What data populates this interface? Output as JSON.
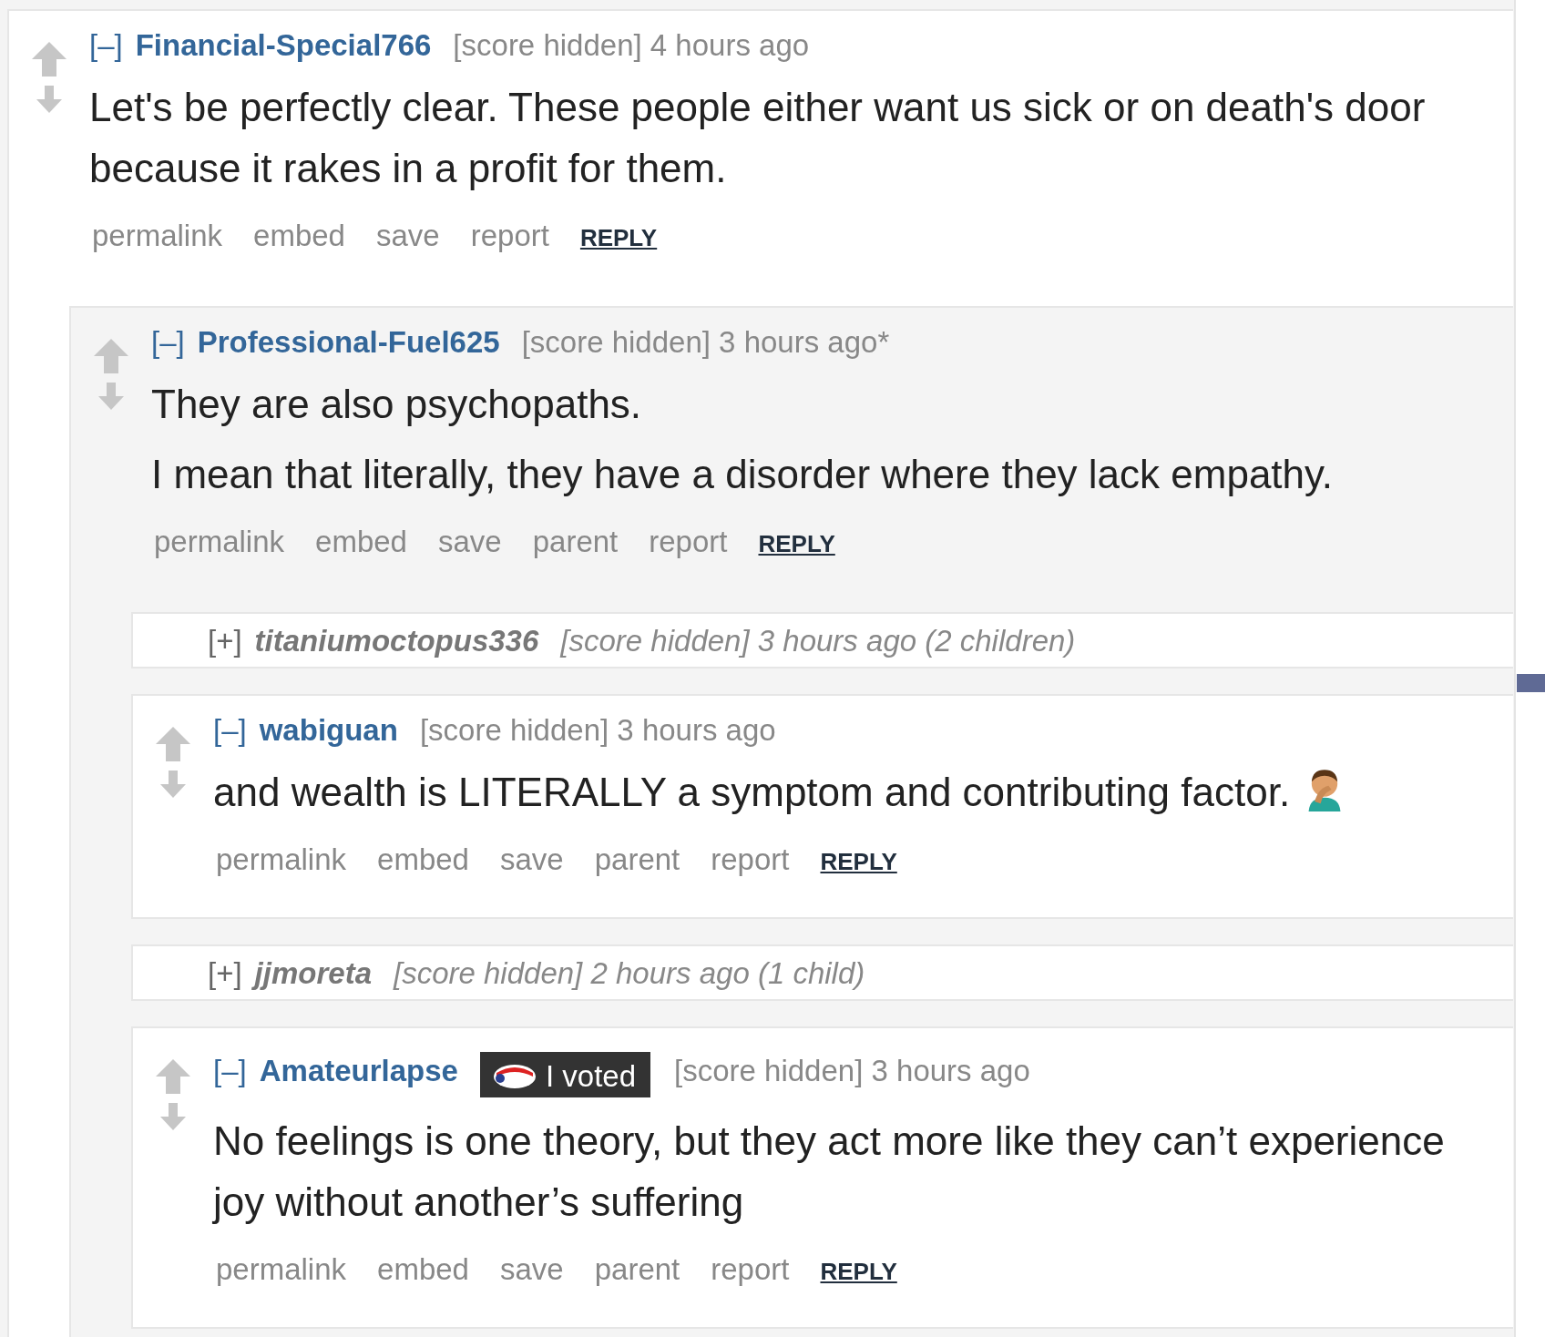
{
  "comments": [
    {
      "kind": "expanded",
      "toggle": "[–]",
      "author": "Financial-Special766",
      "score": "[score hidden]",
      "time": "4 hours ago",
      "body": [
        "Let's be perfectly clear. These people either want us sick or on death's door because it rakes in a profit for them."
      ],
      "buttons": [
        "permalink",
        "embed",
        "save",
        "report"
      ],
      "reply": "REPLY",
      "children": [
        {
          "kind": "expanded",
          "toggle": "[–]",
          "author": "Professional-Fuel625",
          "score": "[score hidden]",
          "time": "3 hours ago*",
          "body": [
            "They are also psychopaths.",
            "I mean that literally, they have a disorder where they lack empathy."
          ],
          "buttons": [
            "permalink",
            "embed",
            "save",
            "parent",
            "report"
          ],
          "reply": "REPLY",
          "children": [
            {
              "kind": "collapsed",
              "toggle": "[+]",
              "author": "titaniumoctopus336",
              "score": "[score hidden]",
              "time": "3 hours ago",
              "count": "(2 children)"
            },
            {
              "kind": "expanded",
              "toggle": "[–]",
              "author": "wabiguan",
              "score": "[score hidden]",
              "time": "3 hours ago",
              "body": [
                "and wealth is LITERALLY a symptom and contributing factor."
              ],
              "emoji": true,
              "buttons": [
                "permalink",
                "embed",
                "save",
                "parent",
                "report"
              ],
              "reply": "REPLY"
            },
            {
              "kind": "collapsed",
              "toggle": "[+]",
              "author": "jjmoreta",
              "score": "[score hidden]",
              "time": "2 hours ago",
              "count": "(1 child)"
            },
            {
              "kind": "expanded",
              "toggle": "[–]",
              "author": "Amateurlapse",
              "flair": "I voted",
              "score": "[score hidden]",
              "time": "3 hours ago",
              "body": [
                "No feelings is one theory, but they act more like they can’t experience joy without another’s suffering"
              ],
              "buttons": [
                "permalink",
                "embed",
                "save",
                "parent",
                "report"
              ],
              "reply": "REPLY"
            }
          ]
        }
      ]
    }
  ]
}
